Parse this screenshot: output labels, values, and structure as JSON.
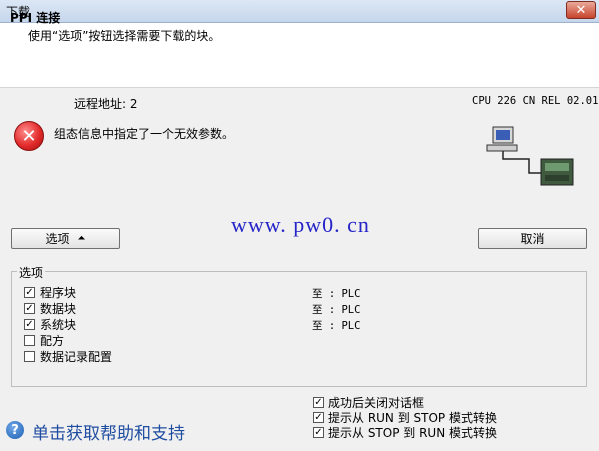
{
  "window": {
    "title": "下载",
    "close_glyph": "✕"
  },
  "header": {
    "title": "PPI 连接",
    "subtitle": "使用“选项”按钮选择需要下载的块。"
  },
  "info": {
    "remote_address": "远程地址: 2",
    "cpu": "CPU 226 CN REL 02.01",
    "error_message": "组态信息中指定了一个无效参数。"
  },
  "watermark": "www. pw0. cn",
  "buttons": {
    "options_label": "选项",
    "options_arrow": "⏶",
    "cancel_label": "取消"
  },
  "options_group": {
    "legend": "选项",
    "items": [
      {
        "label": "程序块",
        "checked": true,
        "target": "至 : PLC"
      },
      {
        "label": "数据块",
        "checked": true,
        "target": "至 : PLC"
      },
      {
        "label": "系统块",
        "checked": true,
        "target": "至 : PLC"
      },
      {
        "label": "配方",
        "checked": false
      },
      {
        "label": "数据记录配置",
        "checked": false
      }
    ]
  },
  "bottom_options": [
    {
      "label": "成功后关闭对话框",
      "checked": true
    },
    {
      "label": "提示从 RUN 到 STOP 模式转换",
      "checked": true
    },
    {
      "label": "提示从 STOP 到 RUN 模式转换",
      "checked": true
    }
  ],
  "help_link": "单击获取帮助和支持",
  "colors": {
    "watermark": "#2424c8",
    "help_link": "#1f4da1",
    "error_red": "#e32b2b"
  }
}
